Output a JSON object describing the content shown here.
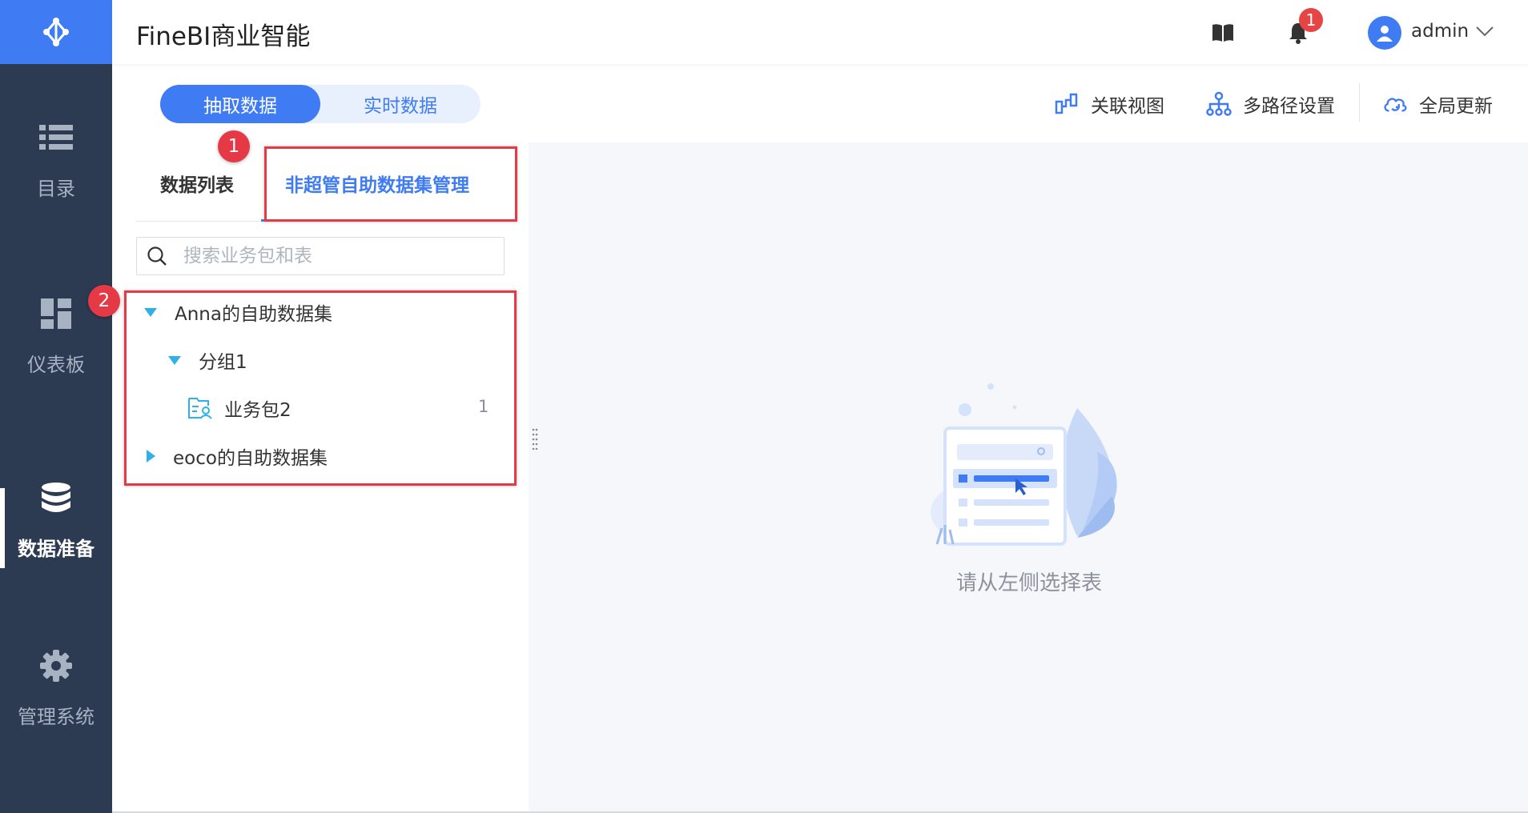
{
  "app": {
    "title": "FineBI商业智能"
  },
  "sidebar": {
    "items": [
      {
        "label": "目录",
        "icon": "list-icon"
      },
      {
        "label": "仪表板",
        "icon": "dashboard-icon"
      },
      {
        "label": "数据准备",
        "icon": "database-icon",
        "active": true
      },
      {
        "label": "管理系统",
        "icon": "gear-icon"
      }
    ]
  },
  "header": {
    "notification_count": "1",
    "username": "admin"
  },
  "mode_toggle": {
    "extract": "抽取数据",
    "realtime": "实时数据",
    "selected": "抽取数据"
  },
  "toolbar": {
    "relation_view": "关联视图",
    "multipath": "多路径设置",
    "global_update": "全局更新"
  },
  "tabs": {
    "data_list": "数据列表",
    "self_service": "非超管自助数据集管理",
    "selected": "非超管自助数据集管理"
  },
  "search": {
    "placeholder": "搜索业务包和表"
  },
  "tree": {
    "nodes": [
      {
        "label": "Anna的自助数据集",
        "expanded": true
      },
      {
        "label": "分组1",
        "expanded": true
      },
      {
        "label": "业务包2",
        "count": "1"
      },
      {
        "label": "eoco的自助数据集",
        "expanded": false
      }
    ]
  },
  "empty_state": {
    "text": "请从左侧选择表"
  },
  "annotations": {
    "one": "1",
    "two": "2"
  },
  "colors": {
    "accent": "#3f7cf4",
    "sidebar": "#2c3a52",
    "annotation": "#e63946",
    "caret": "#2eb0e9"
  }
}
